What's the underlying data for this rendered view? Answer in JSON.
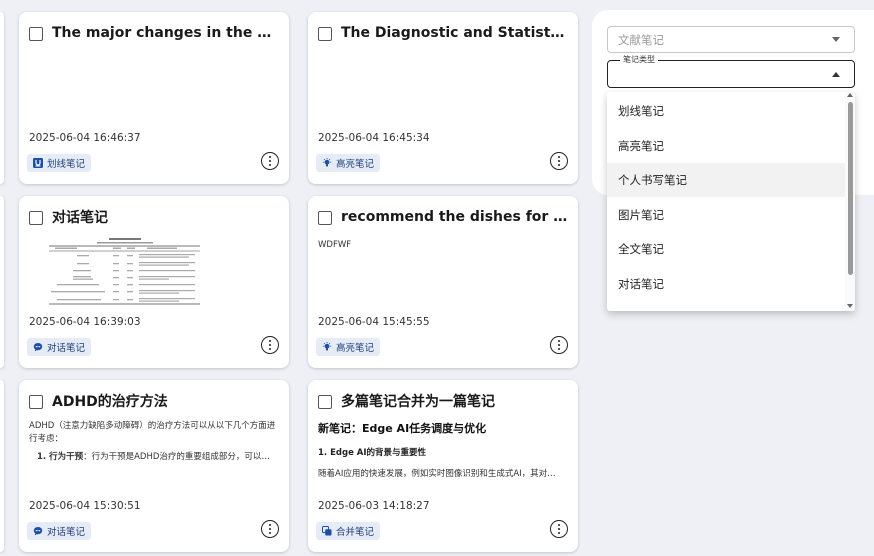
{
  "cards": [
    {
      "title": "The major changes in the ASD…",
      "timestamp": "2025-06-04 16:46:37",
      "tag": "划线笔记",
      "tag_icon": "underline-icon"
    },
    {
      "title": "The Diagnostic and Statistical Man…",
      "timestamp": "2025-06-04 16:45:34",
      "tag": "高亮笔记",
      "tag_icon": "highlight-icon"
    },
    {
      "title": "对话笔记",
      "timestamp": "2025-06-04 16:39:03",
      "tag": "对话笔记",
      "tag_icon": "chat-icon"
    },
    {
      "title": "recommend the dishes for the…",
      "body": "WDFWF",
      "timestamp": "2025-06-04 15:45:55",
      "tag": "高亮笔记",
      "tag_icon": "highlight-icon"
    },
    {
      "title": "ADHD的治疗方法",
      "body_line1": "ADHD（注意力缺陷多动障碍）的治疗方法可以从以下几个方面进行考虑：",
      "body_item_bold": "1. 行为干预",
      "body_item_rest": "：行为干预是ADHD治疗的重要组成部分，可以…",
      "timestamp": "2025-06-04 15:30:51",
      "tag": "对话笔记",
      "tag_icon": "chat-icon"
    },
    {
      "title": "多篇笔记合并为一篇笔记",
      "subtitle": "新笔记：Edge AI任务调度与优化",
      "section": "1. Edge AI的背景与重要性",
      "excerpt": "随着AI应用的快速发展，例如实时图像识别和生成式AI，其对…",
      "timestamp": "2025-06-03 14:18:27",
      "tag": "合并笔记",
      "tag_icon": "merge-icon"
    }
  ],
  "filters": {
    "doc_note_placeholder": "文献笔记",
    "note_type_label": "笔记类型",
    "note_type_value": "",
    "options": [
      "划线笔记",
      "高亮笔记",
      "个人书写笔记",
      "图片笔记",
      "全文笔记",
      "对话笔记"
    ],
    "highlighted_option": "个人书写笔记"
  },
  "colors": {
    "background": "#eef0f5",
    "tag_bg": "#e6ecf6",
    "tag_text": "#1f3d7a",
    "icon_blue": "#1e4fa8"
  }
}
